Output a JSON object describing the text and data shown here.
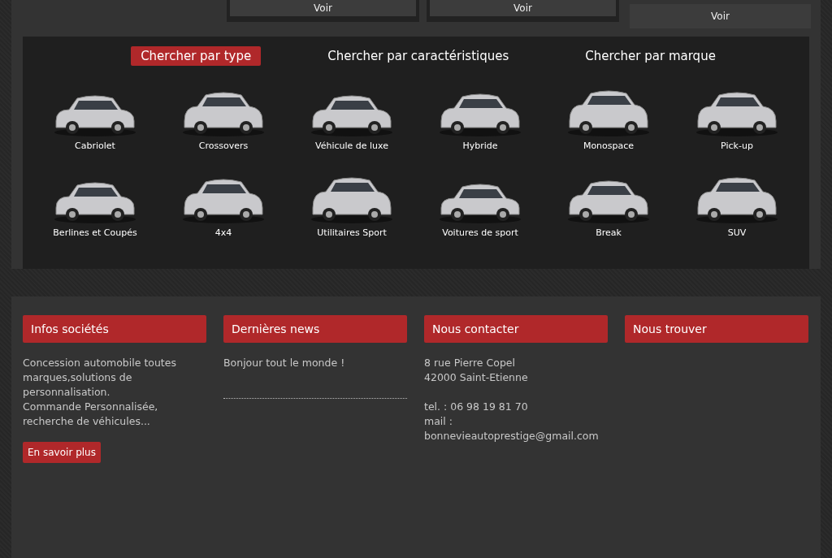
{
  "top_buttons": [
    {
      "label": "Voir"
    },
    {
      "label": "Voir"
    },
    {
      "label": "Voir"
    }
  ],
  "search_tabs": [
    {
      "label": "Chercher par type",
      "selected": true
    },
    {
      "label": "Chercher par caractéristiques",
      "selected": false
    },
    {
      "label": "Chercher par marque",
      "selected": false
    }
  ],
  "vehicle_types": [
    {
      "label": "Cabriolet"
    },
    {
      "label": "Crossovers"
    },
    {
      "label": "Véhicule de luxe"
    },
    {
      "label": "Hybride"
    },
    {
      "label": "Monospace"
    },
    {
      "label": "Pick-up"
    },
    {
      "label": "Berlines et Coupés"
    },
    {
      "label": "4x4"
    },
    {
      "label": "Utilitaires Sport"
    },
    {
      "label": "Voitures de sport"
    },
    {
      "label": "Break"
    },
    {
      "label": "SUV"
    }
  ],
  "footer": [
    {
      "heading": "Infos sociétés",
      "kind": "info",
      "paragraphs": [
        "Concession automobile toutes marques,solutions de personnalisation.",
        "Commande Personnalisée, recherche de véhicules..."
      ],
      "button": "En savoir plus"
    },
    {
      "heading": "Dernières news",
      "kind": "news",
      "items": [
        "Bonjour tout le monde !"
      ]
    },
    {
      "heading": "Nous contacter",
      "kind": "contact",
      "blocks": [
        [
          "8 rue Pierre Copel",
          "42000 Saint-Etienne"
        ],
        [
          "tel. : 06 98 19 81 70",
          "mail : bonnevieautoprestige@gmail.com"
        ]
      ]
    },
    {
      "heading": "Nous trouver",
      "kind": "map"
    }
  ]
}
